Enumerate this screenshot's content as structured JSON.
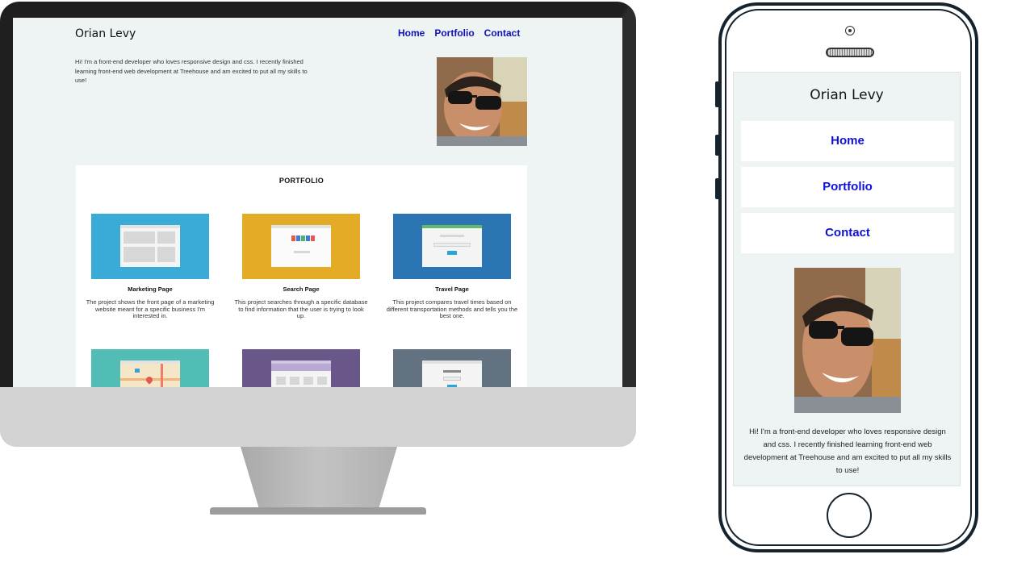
{
  "desktop": {
    "site_name": "Orian Levy",
    "nav": [
      "Home",
      "Portfolio",
      "Contact"
    ],
    "intro": "Hi! I'm a front-end developer who loves responsive design and css. I recently finished learning front-end web development at Treehouse and am excited to put all my skills to use!",
    "portfolio_heading": "PORTFOLIO",
    "projects": [
      {
        "title": "Marketing Page",
        "description": "The project shows the front page of a marketing website meant for a specific business I'm interested in.",
        "color": "#39abd6"
      },
      {
        "title": "Search Page",
        "description": "This project searches through a specific database to find information that the user is trying to look up.",
        "color": "#e3ab26"
      },
      {
        "title": "Travel Page",
        "description": "This project compares travel times based on different transportation methods and tells you the best one.",
        "color": "#2b76b2"
      }
    ],
    "more_projects_colors": [
      "#52bdb4",
      "#6a578a",
      "#627281"
    ]
  },
  "mobile": {
    "site_name": "Orian Levy",
    "nav": [
      "Home",
      "Portfolio",
      "Contact"
    ],
    "intro": "Hi! I'm a front-end developer who loves responsive design and css. I recently finished learning front-end web development at Treehouse and am excited to put all my skills to use!"
  },
  "colors": {
    "nav_link": "#1010b8",
    "page_bg": "#eef4f4",
    "device_frame": "#14232e"
  }
}
